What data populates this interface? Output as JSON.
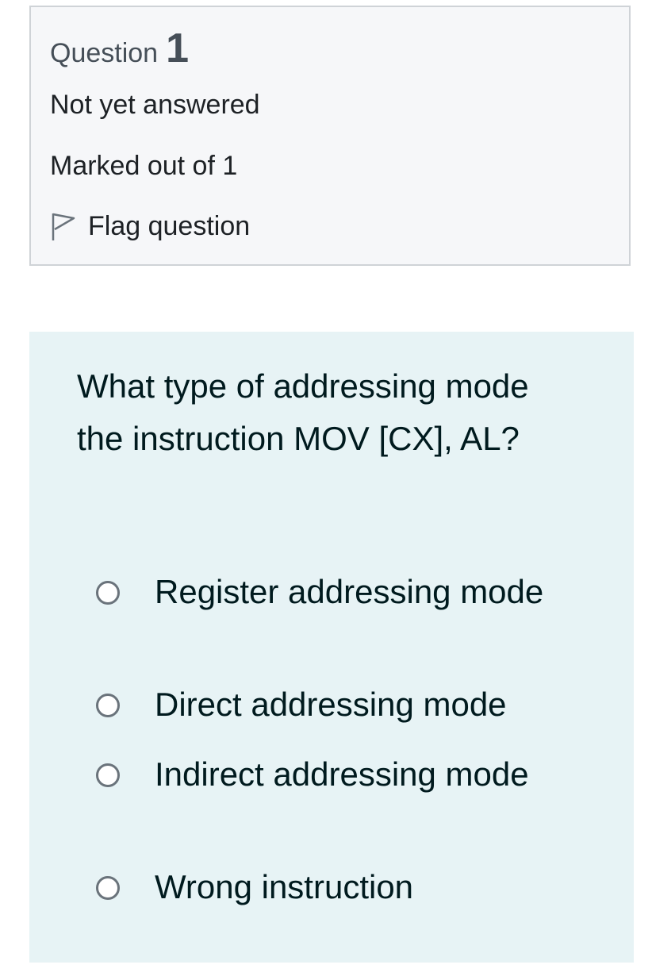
{
  "info": {
    "question_label": "Question",
    "question_number": "1",
    "state": "Not yet answered",
    "grade": "Marked out of 1",
    "flag_label": "Flag question",
    "flag_icon": "flag-outline-icon"
  },
  "question": {
    "text": "What type of addressing mode the instruction MOV [CX], AL?",
    "answers": [
      {
        "label": "Register addressing mode",
        "selected": false
      },
      {
        "label": "Direct addressing mode",
        "selected": false
      },
      {
        "label": "Indirect addressing mode",
        "selected": false
      },
      {
        "label": "Wrong instruction",
        "selected": false
      }
    ]
  },
  "colors": {
    "info_background": "#f6f7f9",
    "info_border": "#cfd3d7",
    "content_background": "#e7f3f5",
    "text": "#001a1e",
    "muted_text": "#464f58"
  }
}
